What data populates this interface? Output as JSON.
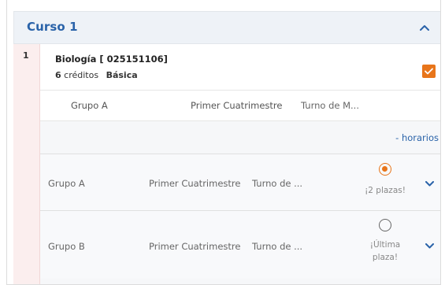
{
  "course_section": {
    "title": "Curso 1"
  },
  "subject": {
    "row_number": "1",
    "title": "Biología [ 025151106]",
    "credits_value": "6",
    "credits_label": "créditos",
    "category": "Básica"
  },
  "selected_group": {
    "group": "Grupo A",
    "semester": "Primer Cuatrimestre",
    "shift": "Turno de M..."
  },
  "schedule_link": "- horarios",
  "group_options": [
    {
      "group": "Grupo A",
      "semester": "Primer Cuatrimestre",
      "shift": "Turno de ...",
      "availability": "¡2 plazas!",
      "selected": true
    },
    {
      "group": "Grupo B",
      "semester": "Primer Cuatrimestre",
      "shift": "Turno de ...",
      "availability_line1": "¡Última",
      "availability_line2": "plaza!",
      "selected": false
    }
  ],
  "colors": {
    "accent_blue": "#2a63a9",
    "accent_orange": "#e8751a",
    "gutter_pink": "#fbeeee"
  }
}
